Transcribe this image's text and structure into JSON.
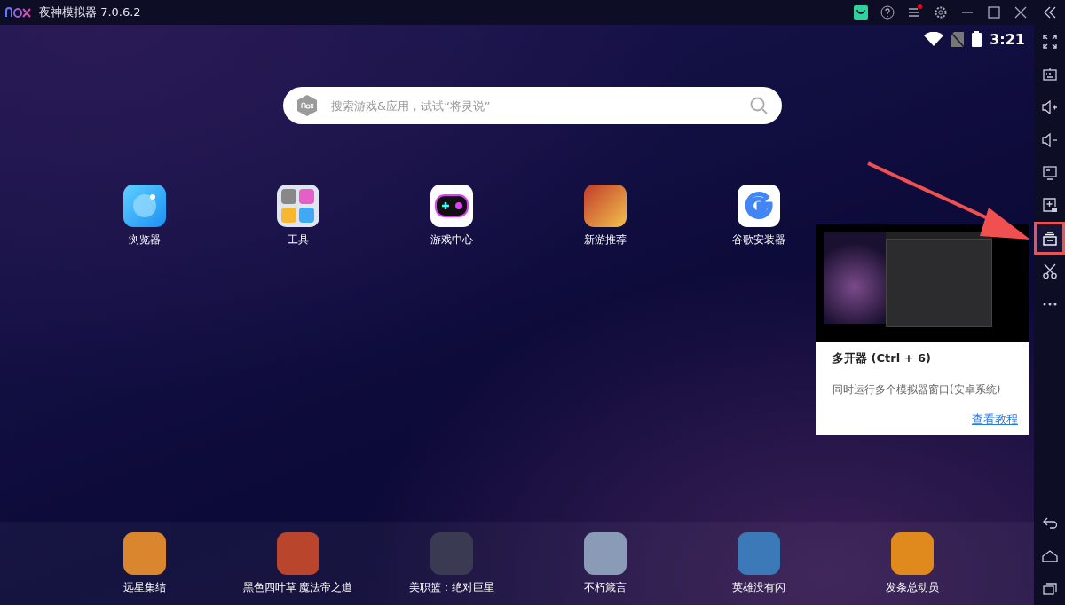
{
  "window": {
    "title": "夜神模拟器 7.0.6.2",
    "controls": [
      {
        "kind": "store"
      },
      {
        "kind": "help"
      },
      {
        "kind": "menu",
        "badge": true
      },
      {
        "kind": "settings"
      },
      {
        "kind": "minimize"
      },
      {
        "kind": "maximize"
      },
      {
        "kind": "close"
      }
    ]
  },
  "status_bar": {
    "time": "3:21"
  },
  "search": {
    "placeholder": "搜索游戏&应用，试试“将灵说”"
  },
  "apps": [
    {
      "label": "浏览器",
      "kind": "browser"
    },
    {
      "label": "工具",
      "kind": "tools"
    },
    {
      "label": "游戏中心",
      "kind": "gamecenter"
    },
    {
      "label": "新游推荐",
      "kind": "game"
    },
    {
      "label": "谷歌安装器",
      "kind": "google"
    }
  ],
  "dock": [
    {
      "label": "远星集结",
      "color": "#d9862e"
    },
    {
      "label": "黑色四叶草 魔法帝之道",
      "color": "#b8452c"
    },
    {
      "label": "美职篮：绝对巨星",
      "color": "#3a3a52"
    },
    {
      "label": "不朽箴言",
      "color": "#8a9bb8"
    },
    {
      "label": "英雄没有闪",
      "color": "#3c79b8"
    },
    {
      "label": "发条总动员",
      "color": "#e08a1e"
    }
  ],
  "sidebar": {
    "top": [
      {
        "kind": "collapse",
        "highlighted": false
      },
      {
        "kind": "fullscreen",
        "highlighted": false
      },
      {
        "kind": "keyboard",
        "highlighted": false
      },
      {
        "kind": "volume-up",
        "highlighted": false
      },
      {
        "kind": "volume-down",
        "highlighted": false
      },
      {
        "kind": "screen",
        "highlighted": false
      },
      {
        "kind": "apk",
        "highlighted": false
      },
      {
        "kind": "multi",
        "highlighted": true
      },
      {
        "kind": "scissors",
        "highlighted": false
      },
      {
        "kind": "more",
        "highlighted": false
      }
    ],
    "bottom": [
      {
        "kind": "back",
        "highlighted": false
      },
      {
        "kind": "home",
        "highlighted": false
      },
      {
        "kind": "recents",
        "highlighted": false
      }
    ]
  },
  "tooltip": {
    "title": "多开器 (Ctrl + 6)",
    "description": "同时运行多个模拟器窗口(安卓系统)",
    "link": "查看教程"
  }
}
